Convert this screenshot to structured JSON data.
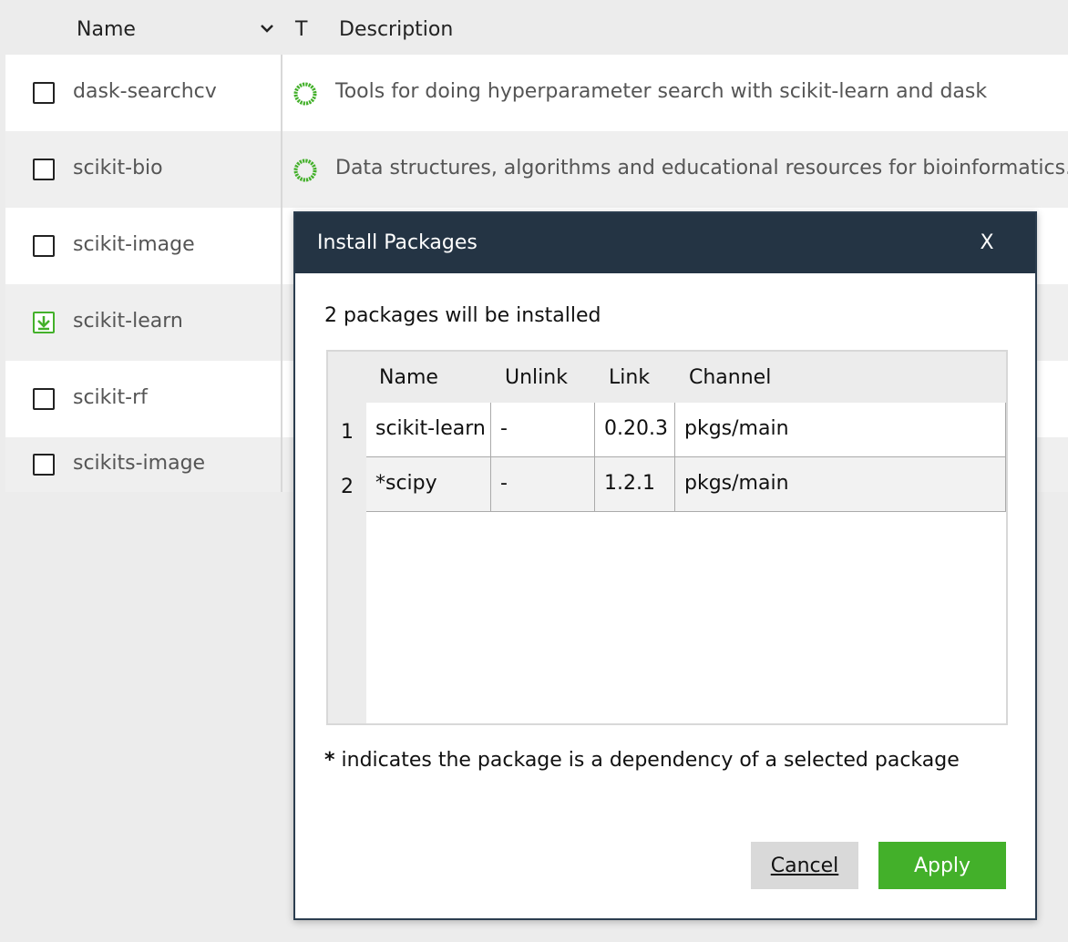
{
  "package_list": {
    "header": {
      "name": "Name",
      "type": "T",
      "description": "Description"
    },
    "rows": [
      {
        "name": "dask-searchcv",
        "selected": false,
        "description": "Tools for doing hyperparameter search with scikit-learn and dask"
      },
      {
        "name": "scikit-bio",
        "selected": false,
        "description": "Data structures, algorithms and educational resources for bioinformatics."
      },
      {
        "name": "scikit-image",
        "selected": false,
        "description": ""
      },
      {
        "name": "scikit-learn",
        "selected": true,
        "description": ""
      },
      {
        "name": "scikit-rf",
        "selected": false,
        "description": ""
      },
      {
        "name": "scikits-image",
        "selected": false,
        "description": ""
      }
    ]
  },
  "dialog": {
    "title": "Install Packages",
    "close_label": "X",
    "message": "2 packages will be installed",
    "table": {
      "columns": [
        "Name",
        "Unlink",
        "Link",
        "Channel"
      ],
      "rows": [
        {
          "index": "1",
          "name": "scikit-learn",
          "unlink": "-",
          "link": "0.20.3",
          "channel": "pkgs/main"
        },
        {
          "index": "2",
          "name": "*scipy",
          "unlink": "-",
          "link": "1.2.1",
          "channel": "pkgs/main"
        }
      ]
    },
    "note_star": "*",
    "note_text": " indicates the package is a dependency of a selected package",
    "cancel_label": "Cancel",
    "apply_label": "Apply"
  },
  "colors": {
    "accent_green": "#43b02a",
    "titlebar": "#243444"
  },
  "icons": {
    "status": "installable-ring-icon",
    "selected_check": "install-arrow-icon"
  }
}
